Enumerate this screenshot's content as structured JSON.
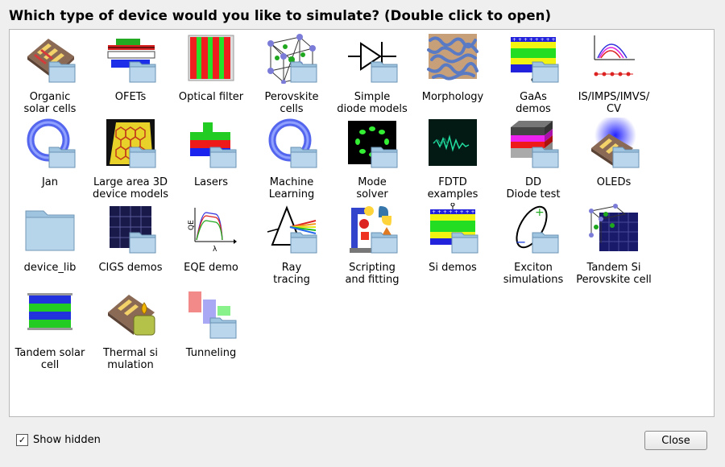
{
  "dialog": {
    "title": "Which type of device would you like to simulate? (Double click to open)",
    "show_hidden_label": "Show hidden",
    "show_hidden_checked": true,
    "checkbox_mark": "✓",
    "close_label": "Close"
  },
  "items": [
    {
      "label": "Organic\nsolar cells",
      "icon": "solar-cell-icon"
    },
    {
      "label": "OFETs",
      "icon": "ofet-icon"
    },
    {
      "label": "Optical filter",
      "icon": "optical-filter-icon"
    },
    {
      "label": "Perovskite\ncells",
      "icon": "perovskite-icon"
    },
    {
      "label": "Simple\ndiode models",
      "icon": "diode-icon"
    },
    {
      "label": "Morphology",
      "icon": "morphology-icon"
    },
    {
      "label": "GaAs\ndemos",
      "icon": "gaas-icon"
    },
    {
      "label": "IS/IMPS/IMVS/\nCV",
      "icon": "impedance-icon"
    },
    {
      "label": "Jan",
      "icon": "ring-icon"
    },
    {
      "label": "Large area 3D\ndevice models",
      "icon": "hexagon-grid-icon"
    },
    {
      "label": "Lasers",
      "icon": "laser-icon"
    },
    {
      "label": "Machine\nLearning",
      "icon": "ring-icon"
    },
    {
      "label": "Mode\nsolver",
      "icon": "mode-solver-icon"
    },
    {
      "label": "FDTD\nexamples",
      "icon": "fdtd-icon"
    },
    {
      "label": "DD\nDiode test",
      "icon": "layer-stack-icon"
    },
    {
      "label": "OLEDs",
      "icon": "oled-icon"
    },
    {
      "label": "device_lib",
      "icon": "folder-icon"
    },
    {
      "label": "CIGS demos",
      "icon": "cigs-panel-icon"
    },
    {
      "label": "EQE demo",
      "icon": "eqe-icon"
    },
    {
      "label": "Ray\ntracing",
      "icon": "prism-icon"
    },
    {
      "label": "Scripting\nand fitting",
      "icon": "scripting-icon"
    },
    {
      "label": "Si demos",
      "icon": "si-icon"
    },
    {
      "label": "Exciton\nsimulations",
      "icon": "exciton-icon"
    },
    {
      "label": "Tandem Si\nPerovskite cell",
      "icon": "tandem-perovskite-icon"
    },
    {
      "label": "Tandem solar\ncell",
      "icon": "tandem-cell-icon"
    },
    {
      "label": "Thermal si\nmulation",
      "icon": "thermal-icon"
    },
    {
      "label": "Tunneling",
      "icon": "tunneling-icon"
    }
  ]
}
